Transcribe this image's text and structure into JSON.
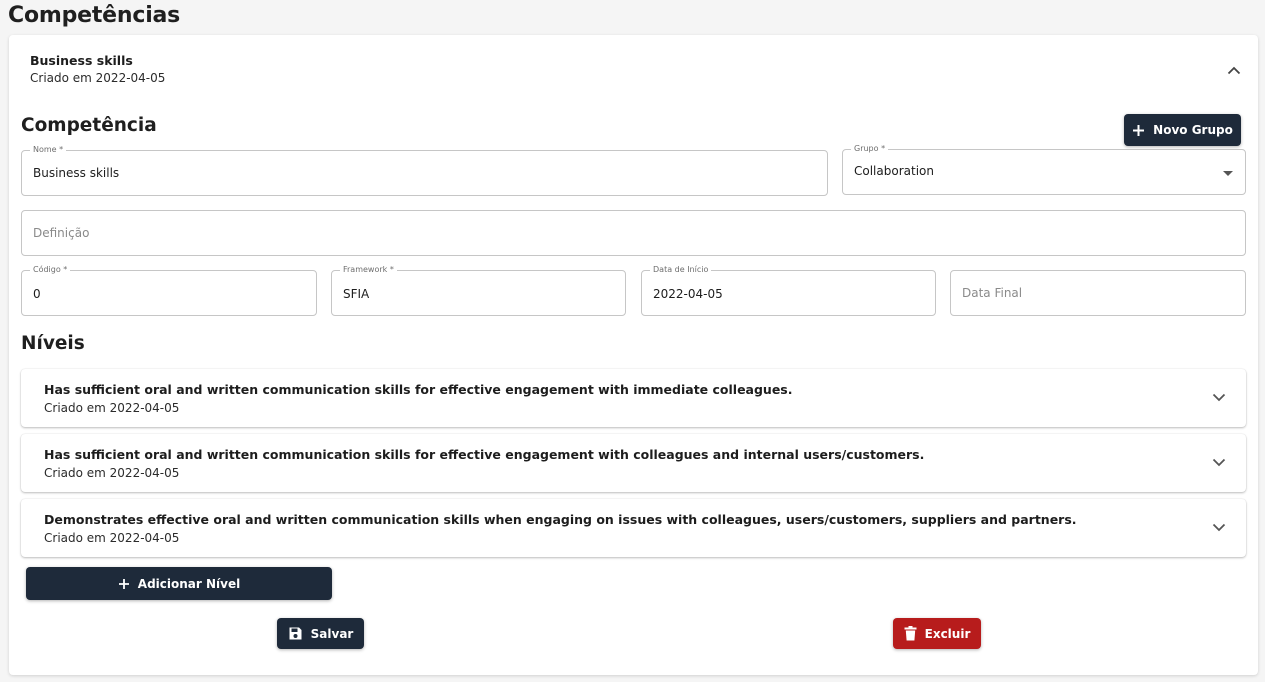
{
  "page": {
    "title": "Competências"
  },
  "accordion": {
    "title": "Business skills",
    "created": "Criado em 2022-04-05"
  },
  "form": {
    "section_title": "Competência",
    "new_group_button": "Novo Grupo",
    "name": {
      "label": "Nome *",
      "value": "Business skills"
    },
    "group": {
      "label": "Grupo *",
      "value": "Collaboration"
    },
    "definition": {
      "placeholder": "Definição"
    },
    "code": {
      "label": "Código *",
      "value": "0"
    },
    "framework": {
      "label": "Framework *",
      "value": "SFIA"
    },
    "start_date": {
      "label": "Data de Início",
      "value": "2022-04-05"
    },
    "end_date": {
      "placeholder": "Data Final"
    }
  },
  "levels": {
    "section_title": "Níveis",
    "items": [
      {
        "title": "Has sufficient oral and written communication skills for effective engagement with immediate colleagues.",
        "created": "Criado em 2022-04-05"
      },
      {
        "title": "Has sufficient oral and written communication skills for effective engagement with colleagues and internal users/customers.",
        "created": "Criado em 2022-04-05"
      },
      {
        "title": "Demonstrates effective oral and written communication skills when engaging on issues with colleagues, users/customers, suppliers and partners.",
        "created": "Criado em 2022-04-05"
      }
    ],
    "add_button": "Adicionar Nível"
  },
  "actions": {
    "save_label": "Salvar",
    "delete_label": "Excluir"
  },
  "colors": {
    "primary": "#1e2a3a",
    "danger": "#b71c1c"
  },
  "icons": {
    "collapse": "chevron-up-icon",
    "expand": "chevron-down-icon",
    "add": "plus-icon",
    "save": "floppy-disk-icon",
    "delete": "trash-icon"
  }
}
